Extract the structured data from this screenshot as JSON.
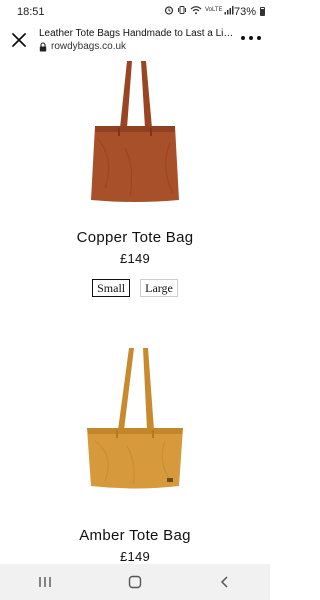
{
  "status_bar": {
    "time": "18:51",
    "network_label": "VoLTE",
    "battery_percent": "73%",
    "icons": [
      "alarm-icon",
      "vibrate-icon",
      "wifi-icon",
      "signal-icon",
      "battery-icon"
    ]
  },
  "browser": {
    "page_title": "Leather Tote Bags Handmade to Last a Lif...",
    "url": "rowdybags.co.uk",
    "close_icon": "close-icon",
    "menu_icon": "more-vertical-icon"
  },
  "products": [
    {
      "name": "Copper Tote Bag",
      "price": "£149",
      "color": "#a8502a",
      "handle_color": "#9a4522",
      "sizes": [
        {
          "label": "Small",
          "selected": true
        },
        {
          "label": "Large",
          "selected": false
        }
      ]
    },
    {
      "name": "Amber Tote Bag",
      "price": "£149",
      "color": "#d69a3c",
      "handle_color": "#c98a2e"
    }
  ],
  "nav_bar": {
    "icons": [
      "recent-apps-icon",
      "home-icon",
      "back-icon"
    ]
  }
}
